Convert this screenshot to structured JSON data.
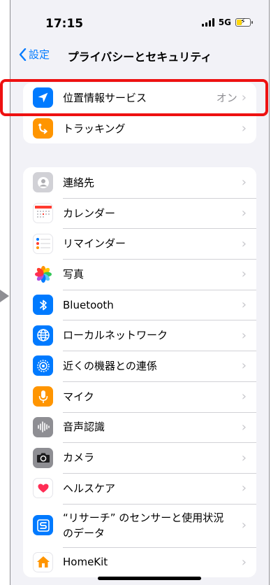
{
  "status_bar": {
    "time": "17:15",
    "network": "5G"
  },
  "nav": {
    "back_label": "設定",
    "title": "プライバシーとセキュリティ"
  },
  "top_items": [
    {
      "label": "位置情報サービス",
      "value": "オン",
      "icon": "location-arrow-icon",
      "color": "#007aff"
    },
    {
      "label": "トラッキング",
      "icon": "tracking-icon",
      "color": "#ff9500"
    }
  ],
  "permissions": [
    {
      "label": "連絡先",
      "icon": "contacts-icon",
      "color": "#d1d1d6"
    },
    {
      "label": "カレンダー",
      "icon": "calendar-icon",
      "color": "#ffffff"
    },
    {
      "label": "リマインダー",
      "icon": "reminders-icon",
      "color": "#ffffff"
    },
    {
      "label": "写真",
      "icon": "photos-icon",
      "color": "#ffffff"
    },
    {
      "label": "Bluetooth",
      "icon": "bluetooth-icon",
      "color": "#007aff"
    },
    {
      "label": "ローカルネットワーク",
      "icon": "globe-icon",
      "color": "#007aff"
    },
    {
      "label": "近くの機器との連係",
      "icon": "nearby-icon",
      "color": "#007aff"
    },
    {
      "label": "マイク",
      "icon": "microphone-icon",
      "color": "#ff9500"
    },
    {
      "label": "音声認識",
      "icon": "speech-waveform-icon",
      "color": "#8e8e93"
    },
    {
      "label": "カメラ",
      "icon": "camera-icon",
      "color": "#8e8e93"
    },
    {
      "label": "ヘルスケア",
      "icon": "heart-icon",
      "color": "#ffffff"
    },
    {
      "label": "“リサーチ” のセンサーと使用状況のデータ",
      "icon": "research-icon",
      "color": "#007aff"
    },
    {
      "label": "HomeKit",
      "icon": "home-icon",
      "color": "#ffffff"
    }
  ]
}
